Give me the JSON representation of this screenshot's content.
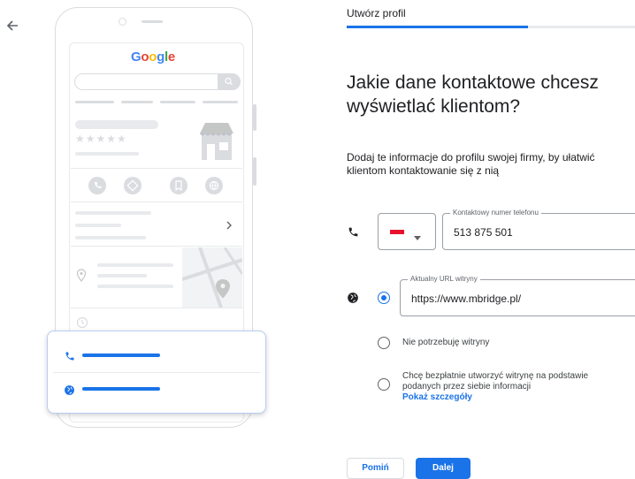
{
  "illustration": {
    "google_logo": {
      "letters": [
        "G",
        "o",
        "o",
        "g",
        "l",
        "e"
      ],
      "colors": [
        "#4285F4",
        "#EA4335",
        "#FBBC05",
        "#4285F4",
        "#34A853",
        "#EA4335"
      ]
    },
    "rating_stars": "★★★★★"
  },
  "header": {
    "step_label": "Utwórz profil",
    "progress": 0.63
  },
  "main": {
    "title": "Jakie dane kontaktowe chcesz wyświetlać klientom?",
    "description_line1": "Dodaj te informacje do profilu swojej firmy, by ułatwić",
    "description_line2": "klientom kontaktowanie się z nią"
  },
  "phone_field": {
    "label": "Kontaktowy numer telefonu",
    "value": "513 875 501",
    "country_flag": "poland-flag"
  },
  "website_field": {
    "label": "Aktualny URL witryny",
    "value": "https://www.mbridge.pl/"
  },
  "options": {
    "no_website": "Nie potrzebuję witryny",
    "create_line1": "Chcę bezpłatnie utworzyć witrynę na podstawie",
    "create_line2": "podanych przez siebie informacji",
    "details_link": "Pokaż szczegóły"
  },
  "buttons": {
    "skip": "Pomiń",
    "next": "Dalej"
  },
  "colors": {
    "accent": "#1a73e8"
  }
}
